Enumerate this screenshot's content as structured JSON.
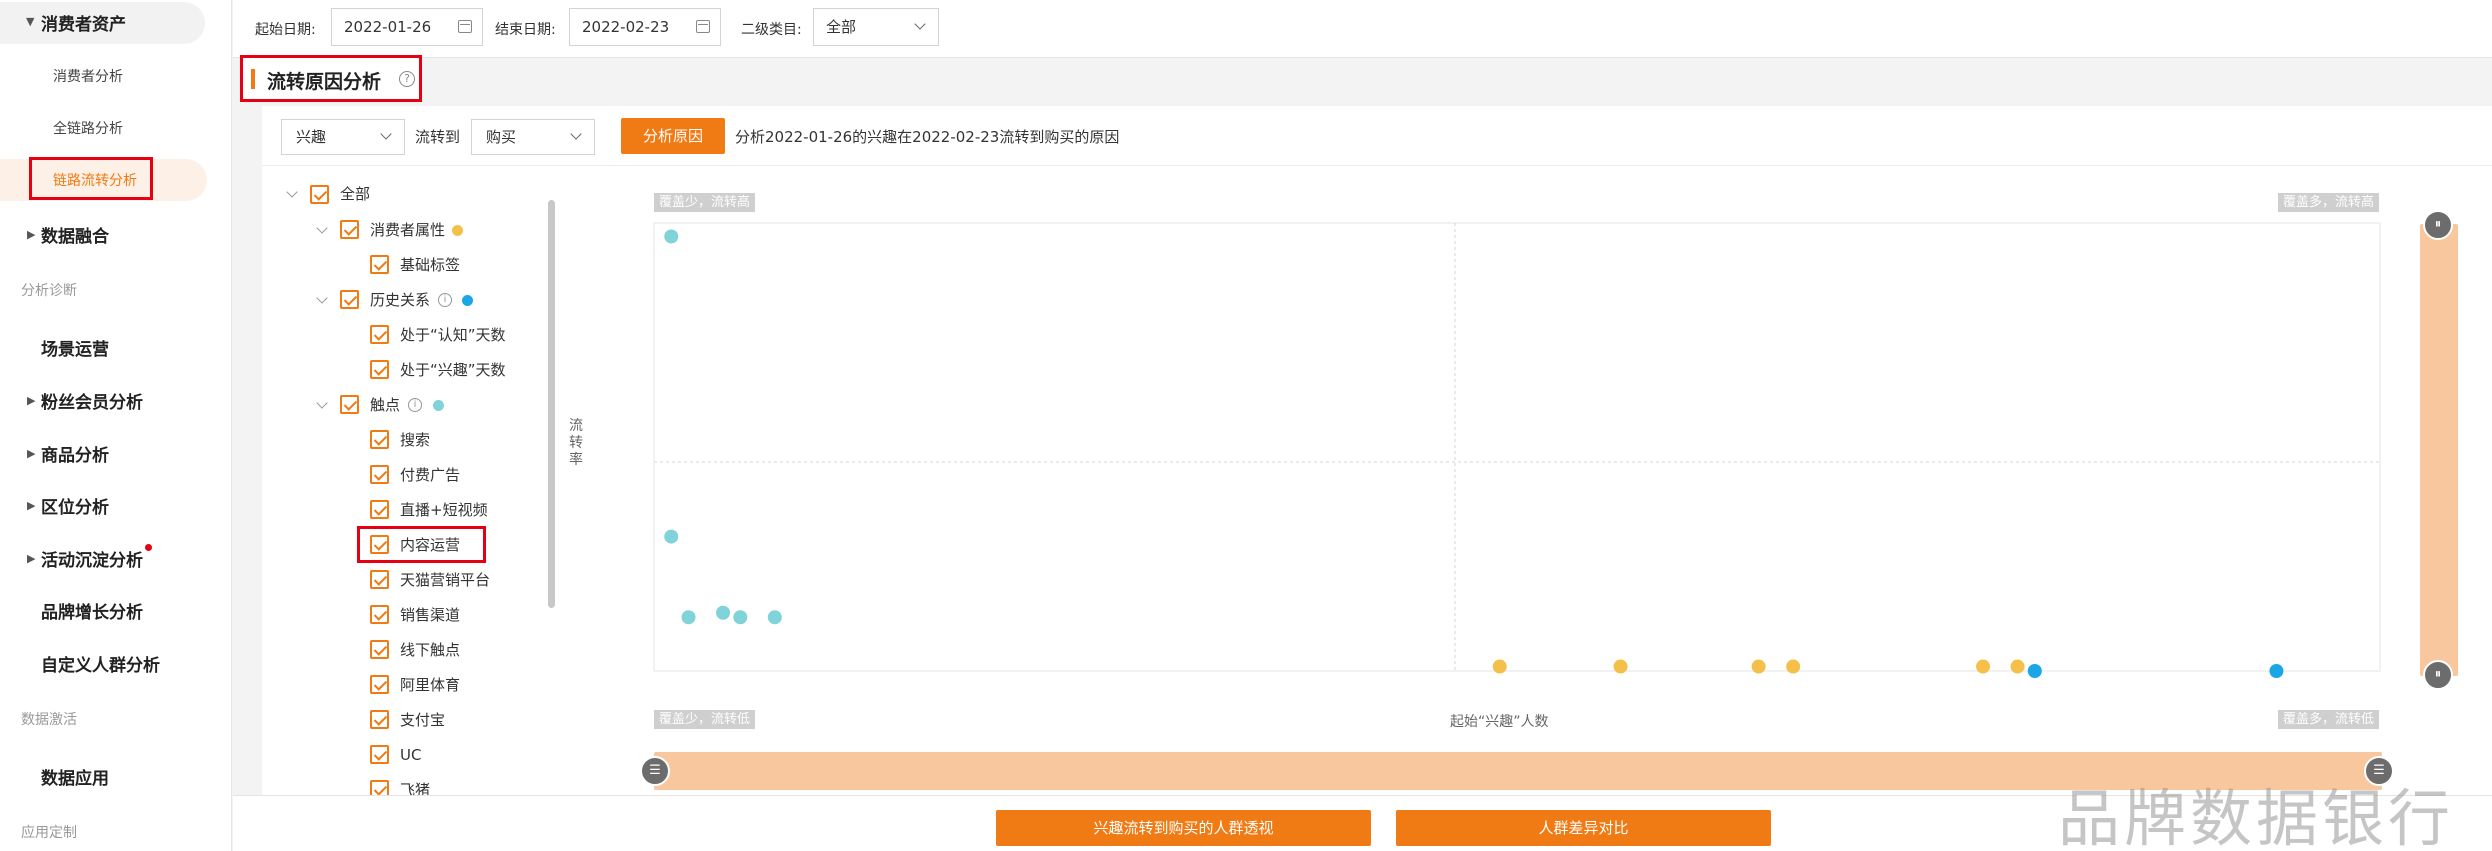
{
  "sidebar": {
    "top_item": "消费者资产",
    "sub_items": [
      "消费者分析",
      "全链路分析",
      "链路流转分析"
    ],
    "items": [
      "数据融合",
      "场景运营",
      "粉丝会员分析",
      "商品分析",
      "区位分析",
      "活动沉淀分析",
      "品牌增长分析",
      "自定义人群分析",
      "数据应用"
    ],
    "sections": [
      "分析诊断",
      "数据激活",
      "应用定制"
    ]
  },
  "filters": {
    "start_label": "起始日期:",
    "start_value": "2022-01-26",
    "end_label": "结束日期:",
    "end_value": "2022-02-23",
    "category_label": "二级类目:",
    "category_value": "全部"
  },
  "section": {
    "title": "流转原因分析",
    "help": "?"
  },
  "controls": {
    "from_value": "兴趣",
    "to_label": "流转到",
    "to_value": "购买",
    "analyze_button": "分析原因",
    "description": "分析2022-01-26的兴趣在2022-02-23流转到购买的原因"
  },
  "tree": {
    "root": "全部",
    "groups": [
      {
        "label": "消费者属性",
        "color": "#f5c04a",
        "children": [
          "基础标签"
        ]
      },
      {
        "label": "历史关系",
        "color": "#1ba6e5",
        "children": [
          "处于“认知”天数",
          "处于“兴趣”天数"
        ]
      },
      {
        "label": "触点",
        "color": "#7fd3d9",
        "children": [
          "搜索",
          "付费广告",
          "直播+短视频",
          "内容运营",
          "天猫营销平台",
          "销售渠道",
          "线下触点",
          "阿里体育",
          "支付宝",
          "UC",
          "飞猪"
        ]
      }
    ]
  },
  "chart": {
    "corner_top_left": "覆盖少，流转高",
    "corner_top_right": "覆盖多，流转高",
    "corner_bottom_left": "覆盖少，流转低",
    "corner_bottom_right": "覆盖多，流转低",
    "xlabel": "起始“兴趣”人数",
    "ylabel": "流转率",
    "handle_v": "⏸",
    "handle_h": "☰"
  },
  "chart_data": {
    "type": "scatter",
    "xlabel": "起始“兴趣”人数",
    "ylabel": "流转率",
    "grid": true,
    "series": [
      {
        "color": "#7fd3d9",
        "points": [
          [
            0.01,
            0.97
          ],
          [
            0.01,
            0.3
          ],
          [
            0.02,
            0.12
          ],
          [
            0.04,
            0.13
          ],
          [
            0.05,
            0.12
          ],
          [
            0.07,
            0.12
          ]
        ]
      },
      {
        "color": "#f5c04a",
        "points": [
          [
            0.49,
            0.01
          ],
          [
            0.56,
            0.01
          ],
          [
            0.64,
            0.01
          ],
          [
            0.66,
            0.01
          ],
          [
            0.77,
            0.01
          ],
          [
            0.79,
            0.01
          ]
        ]
      },
      {
        "color": "#1ba6e5",
        "points": [
          [
            0.8,
            0.0
          ],
          [
            0.94,
            0.0
          ]
        ]
      }
    ]
  },
  "bottom": {
    "button1": "兴趣流转到购买的人群透视",
    "button2": "人群差异对比"
  },
  "watermark": "品牌数据银行",
  "colors": {
    "accent": "#f07a13",
    "highlight": "#e60012"
  }
}
